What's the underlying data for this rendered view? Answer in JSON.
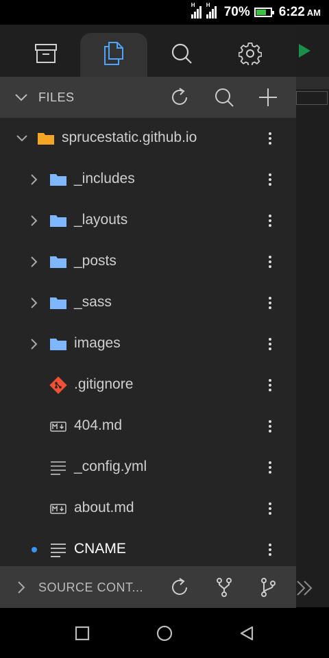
{
  "status_bar": {
    "battery_percent": "70%",
    "battery_level": 0.7,
    "time": "6:22",
    "ampm": "AM",
    "signal_label": "H"
  },
  "drawer": {
    "tabs": [
      {
        "icon": "archive-icon"
      },
      {
        "icon": "files-icon",
        "active": true
      },
      {
        "icon": "search-icon"
      },
      {
        "icon": "gear-icon"
      }
    ],
    "files_header": {
      "label": "FILES"
    },
    "tree": [
      {
        "label": "sprucestatic.github.io",
        "type": "root-folder"
      },
      {
        "label": "_includes",
        "type": "folder"
      },
      {
        "label": "_layouts",
        "type": "folder"
      },
      {
        "label": "_posts",
        "type": "folder"
      },
      {
        "label": "_sass",
        "type": "folder"
      },
      {
        "label": "images",
        "type": "folder"
      },
      {
        "label": ".gitignore",
        "type": "git"
      },
      {
        "label": "404.md",
        "type": "markdown"
      },
      {
        "label": "_config.yml",
        "type": "text"
      },
      {
        "label": "about.md",
        "type": "markdown"
      },
      {
        "label": "CNAME",
        "type": "text",
        "modified": true
      }
    ],
    "source_control": {
      "label": "SOURCE CONT..."
    }
  },
  "colors": {
    "accent_blue": "#3794ff",
    "folder_blue": "#7eb6ff",
    "root_folder": "#f5a623",
    "git_red": "#f05033",
    "run_green": "#1a8f4c"
  }
}
